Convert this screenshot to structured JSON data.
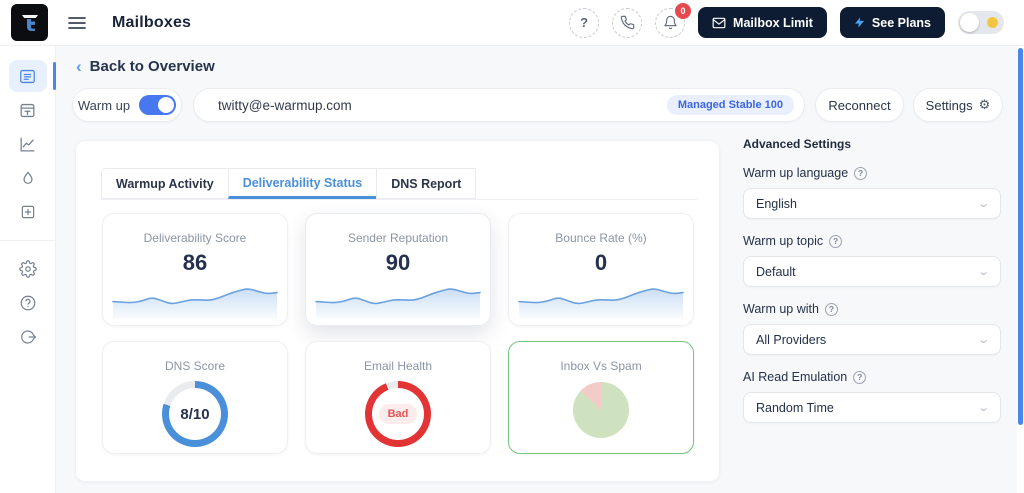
{
  "header": {
    "title": "Mailboxes",
    "notification_badge": "0",
    "mailbox_limit_label": "Mailbox Limit",
    "see_plans_label": "See Plans"
  },
  "toolbar": {
    "back_label": "Back to Overview",
    "warmup_label": "Warm up",
    "warmup_on": true,
    "email": "twitty@e-warmup.com",
    "badge_label": "Managed Stable 100",
    "reconnect_label": "Reconnect",
    "settings_label": "Settings"
  },
  "tabs": [
    {
      "label": "Warmup Activity",
      "active": false
    },
    {
      "label": "Deliverability Status",
      "active": true
    },
    {
      "label": "DNS Report",
      "active": false
    }
  ],
  "cards": [
    {
      "title": "Deliverability Score",
      "value": "86"
    },
    {
      "title": "Sender Reputation",
      "value": "90"
    },
    {
      "title": "Bounce Rate (%)",
      "value": "0"
    },
    {
      "title": "DNS Score",
      "value": "8/10"
    },
    {
      "title": "Email Health",
      "value": "Bad"
    },
    {
      "title": "Inbox Vs Spam",
      "value": ""
    }
  ],
  "advanced_settings": {
    "title": "Advanced Settings",
    "fields": [
      {
        "label": "Warm up language",
        "value": "English"
      },
      {
        "label": "Warm up topic",
        "value": "Default"
      },
      {
        "label": "Warm up with",
        "value": "All Providers"
      },
      {
        "label": "AI Read Emulation",
        "value": "Random Time"
      }
    ]
  },
  "chart_data": [
    {
      "type": "line",
      "name": "deliverability-score-sparkline",
      "values": [
        38,
        36,
        34,
        40,
        52,
        42,
        30,
        36,
        44,
        44,
        42,
        50,
        64,
        74,
        82,
        72,
        64,
        68
      ],
      "color": "#6aa1e0"
    },
    {
      "type": "line",
      "name": "sender-reputation-sparkline",
      "values": [
        38,
        36,
        34,
        40,
        52,
        42,
        30,
        36,
        44,
        44,
        42,
        50,
        64,
        74,
        82,
        72,
        64,
        68
      ],
      "color": "#6aa1e0"
    },
    {
      "type": "line",
      "name": "bounce-rate-sparkline",
      "values": [
        38,
        36,
        34,
        40,
        52,
        42,
        30,
        36,
        44,
        44,
        42,
        50,
        64,
        74,
        82,
        72,
        64,
        68
      ],
      "color": "#6aa1e0"
    },
    {
      "type": "donut",
      "name": "dns-score",
      "value": 8,
      "max": 10,
      "label": "8/10",
      "color": "#4a90d9",
      "track": "#e9ebee"
    },
    {
      "type": "donut",
      "name": "email-health",
      "value": 94,
      "max": 100,
      "label": "Bad",
      "color": "#e23434",
      "track": "#e9ebee"
    },
    {
      "type": "pie",
      "name": "inbox-vs-spam",
      "slices": [
        {
          "label": "Inbox",
          "pct": 87,
          "color": "#cfe2bf"
        },
        {
          "label": "Spam",
          "pct": 13,
          "color": "#f3cbc8"
        }
      ]
    }
  ],
  "colors": {
    "accent_blue": "#4a86e8",
    "navy_button": "#0d1b33",
    "badge_red": "#e5484d",
    "toggle_blue": "#4878f0",
    "card_green_border": "#74c57e"
  }
}
